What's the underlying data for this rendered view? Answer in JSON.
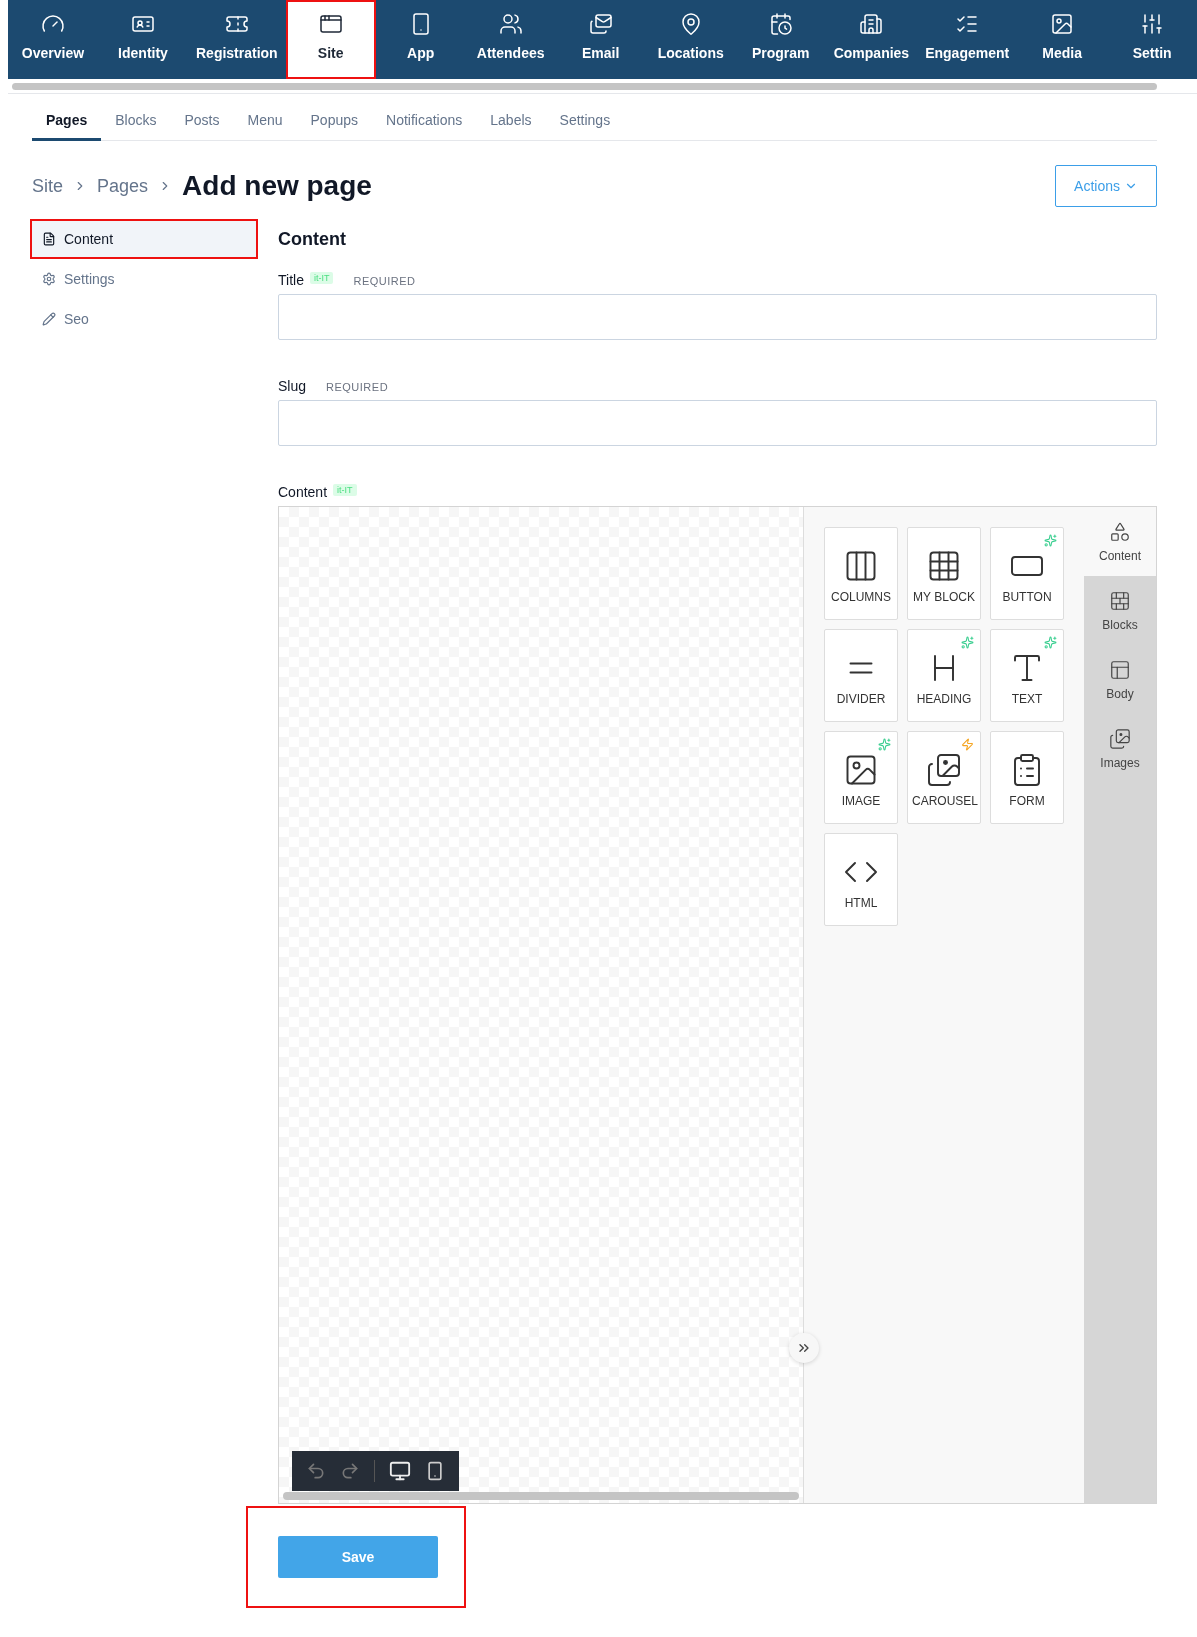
{
  "top_nav": [
    {
      "label": "Overview",
      "selected": false,
      "highlighted": false
    },
    {
      "label": "Identity",
      "selected": false,
      "highlighted": false
    },
    {
      "label": "Registration",
      "selected": false,
      "highlighted": false
    },
    {
      "label": "Site",
      "selected": true,
      "highlighted": true
    },
    {
      "label": "App",
      "selected": false,
      "highlighted": false
    },
    {
      "label": "Attendees",
      "selected": false,
      "highlighted": false
    },
    {
      "label": "Email",
      "selected": false,
      "highlighted": false
    },
    {
      "label": "Locations",
      "selected": false,
      "highlighted": false
    },
    {
      "label": "Program",
      "selected": false,
      "highlighted": false
    },
    {
      "label": "Companies",
      "selected": false,
      "highlighted": false
    },
    {
      "label": "Engagement",
      "selected": false,
      "highlighted": false
    },
    {
      "label": "Media",
      "selected": false,
      "highlighted": false
    },
    {
      "label": "Settin",
      "selected": false,
      "highlighted": false
    }
  ],
  "tabs": [
    {
      "label": "Pages",
      "selected": true
    },
    {
      "label": "Blocks",
      "selected": false
    },
    {
      "label": "Posts",
      "selected": false
    },
    {
      "label": "Menu",
      "selected": false
    },
    {
      "label": "Popups",
      "selected": false
    },
    {
      "label": "Notifications",
      "selected": false
    },
    {
      "label": "Labels",
      "selected": false
    },
    {
      "label": "Settings",
      "selected": false
    }
  ],
  "breadcrumb": [
    "Site",
    "Pages"
  ],
  "page_title": "Add new page",
  "actions_button": "Actions",
  "side_menu": [
    {
      "label": "Content",
      "selected": true,
      "highlighted": true
    },
    {
      "label": "Settings",
      "selected": false,
      "highlighted": false
    },
    {
      "label": "Seo",
      "selected": false,
      "highlighted": false
    }
  ],
  "section_title": "Content",
  "fields": [
    {
      "label": "Title",
      "locale": "it-IT",
      "required": "REQUIRED"
    },
    {
      "label": "Slug",
      "required": "REQUIRED"
    }
  ],
  "editor": {
    "label": "Content",
    "locale": "it-IT",
    "blocks": [
      {
        "label": "COLUMNS",
        "sparkle": false,
        "bolt": false
      },
      {
        "label": "MY BLOCK",
        "sparkle": false,
        "bolt": false
      },
      {
        "label": "BUTTON",
        "sparkle": true,
        "bolt": false
      },
      {
        "label": "DIVIDER",
        "sparkle": false,
        "bolt": false
      },
      {
        "label": "HEADING",
        "sparkle": true,
        "bolt": false
      },
      {
        "label": "TEXT",
        "sparkle": true,
        "bolt": false
      },
      {
        "label": "IMAGE",
        "sparkle": true,
        "bolt": false
      },
      {
        "label": "CAROUSEL",
        "sparkle": false,
        "bolt": true
      },
      {
        "label": "FORM",
        "sparkle": false,
        "bolt": false
      },
      {
        "label": "HTML",
        "sparkle": false,
        "bolt": false
      }
    ],
    "side_tabs": [
      {
        "label": "Content",
        "selected": true
      },
      {
        "label": "Blocks",
        "selected": false
      },
      {
        "label": "Body",
        "selected": false
      },
      {
        "label": "Images",
        "selected": false
      }
    ]
  },
  "save_button": {
    "label": "Save",
    "highlighted": true
  }
}
